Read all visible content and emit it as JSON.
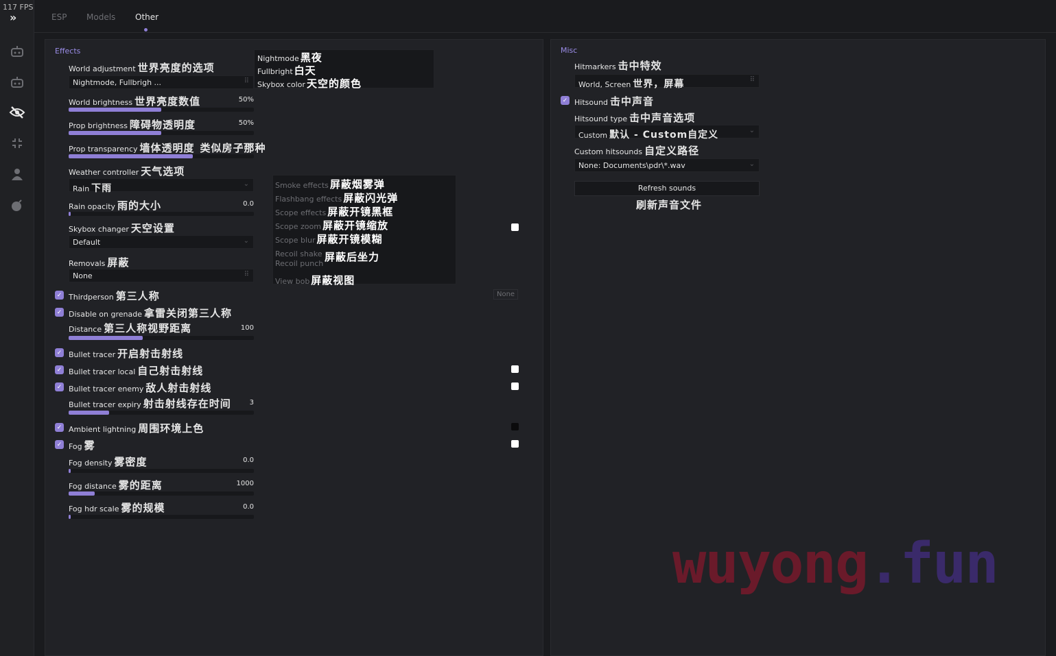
{
  "fps": "117 FPS",
  "tabs": [
    "ESP",
    "Models",
    "Other"
  ],
  "effects": {
    "title": "Effects",
    "world_adjustment": {
      "label": "World adjustment",
      "zh": "世界亮度的选项",
      "value": "Nightmode, Fullbrigh ..."
    },
    "world_popup": [
      {
        "label": "Nightmode",
        "zh": "黑夜"
      },
      {
        "label": "Fullbright",
        "zh": "白天"
      },
      {
        "label": "Skybox color",
        "zh": "天空的颜色"
      }
    ],
    "world_brightness": {
      "label": "World brightness",
      "zh": "世界亮度数值",
      "value": "50%",
      "fraction": 0.5
    },
    "prop_brightness": {
      "label": "Prop brightness",
      "zh": "障碍物透明度",
      "value": "50%",
      "fraction": 0.5
    },
    "prop_transparency": {
      "label": "Prop transparency",
      "zh": "墙体透明度",
      "zh2": "类似房子那种",
      "value": "67%",
      "fraction": 0.67
    },
    "weather_controller": {
      "label": "Weather controller",
      "zh": "天气选项",
      "value": "Rain",
      "value_zh": "下雨"
    },
    "rain_opacity": {
      "label": "Rain opacity",
      "zh": "雨的大小",
      "value": "0.0",
      "fraction": 0.0
    },
    "skybox_changer": {
      "label": "Skybox changer",
      "zh": "天空设置",
      "value": "Default"
    },
    "removals": {
      "label": "Removals",
      "zh": "屏蔽",
      "value": "None"
    },
    "removals_popup": [
      {
        "label": "Smoke effects",
        "zh": "屏蔽烟雾弹"
      },
      {
        "label": "Flashbang effects",
        "zh": "屏蔽闪光弹"
      },
      {
        "label": "Scope effects",
        "zh": "屏蔽开镜黑框"
      },
      {
        "label": "Scope zoom",
        "zh": "屏蔽开镜缩放"
      },
      {
        "label": "Scope blur",
        "zh": "屏蔽开镜模糊"
      },
      {
        "label": "Recoil shake",
        "zh": ""
      },
      {
        "label": "Recoil punch",
        "zh": "屏蔽后坐力"
      },
      {
        "label": "View bob",
        "zh": "屏蔽视图"
      }
    ],
    "none_tag": "None",
    "thirdperson": {
      "label": "Thirdperson",
      "zh": "第三人称"
    },
    "disable_on_grenade": {
      "label": "Disable on grenade",
      "zh": "拿雷关闭第三人称"
    },
    "distance": {
      "label": "Distance",
      "zh": "第三人称视野距离",
      "value": "100",
      "fraction": 0.4
    },
    "bullet_tracer": {
      "label": "Bullet tracer",
      "zh": "开启射击射线"
    },
    "bullet_tracer_local": {
      "label": "Bullet tracer local",
      "zh": "自己射击射线"
    },
    "bullet_tracer_enemy": {
      "label": "Bullet tracer enemy",
      "zh": "敌人射击射线"
    },
    "bullet_tracer_expiry": {
      "label": "Bullet tracer expiry",
      "zh": "射击射线存在时间",
      "value": "3",
      "fraction": 0.22
    },
    "ambient_lightning": {
      "label": "Ambient lightning",
      "zh": "周围环境上色"
    },
    "fog": {
      "label": "Fog",
      "zh": "雾"
    },
    "fog_density": {
      "label": "Fog density",
      "zh": "雾密度",
      "value": "0.0",
      "fraction": 0.0
    },
    "fog_distance": {
      "label": "Fog distance",
      "zh": "雾的距离",
      "value": "1000",
      "fraction": 0.14
    },
    "fog_hdr_scale": {
      "label": "Fog hdr scale",
      "zh": "雾的规模",
      "value": "0.0",
      "fraction": 0.0
    }
  },
  "misc": {
    "title": "Misc",
    "hitmarkers": {
      "label": "Hitmarkers",
      "zh": "击中特效",
      "value": "World, Screen",
      "value_zh": "世界，屏幕"
    },
    "hitsound": {
      "label": "Hitsound",
      "zh": "击中声音"
    },
    "hitsound_type": {
      "label": "Hitsound type",
      "zh": "击中声音选项",
      "value": "Custom",
      "value_zh": "默认 - Custom自定义"
    },
    "custom_hitsounds": {
      "label": "Custom hitsounds",
      "zh": "自定义路径",
      "value": "None: Documents\\pdr\\*.wav"
    },
    "refresh_sounds": {
      "label": "Refresh sounds",
      "zh": "刷新声音文件"
    }
  },
  "watermark": {
    "part1": "wuyong",
    "part2": ".fun"
  },
  "colors": {
    "accent": "#8f7fd6",
    "panel": "#212226",
    "bg": "#1a1b1e"
  }
}
